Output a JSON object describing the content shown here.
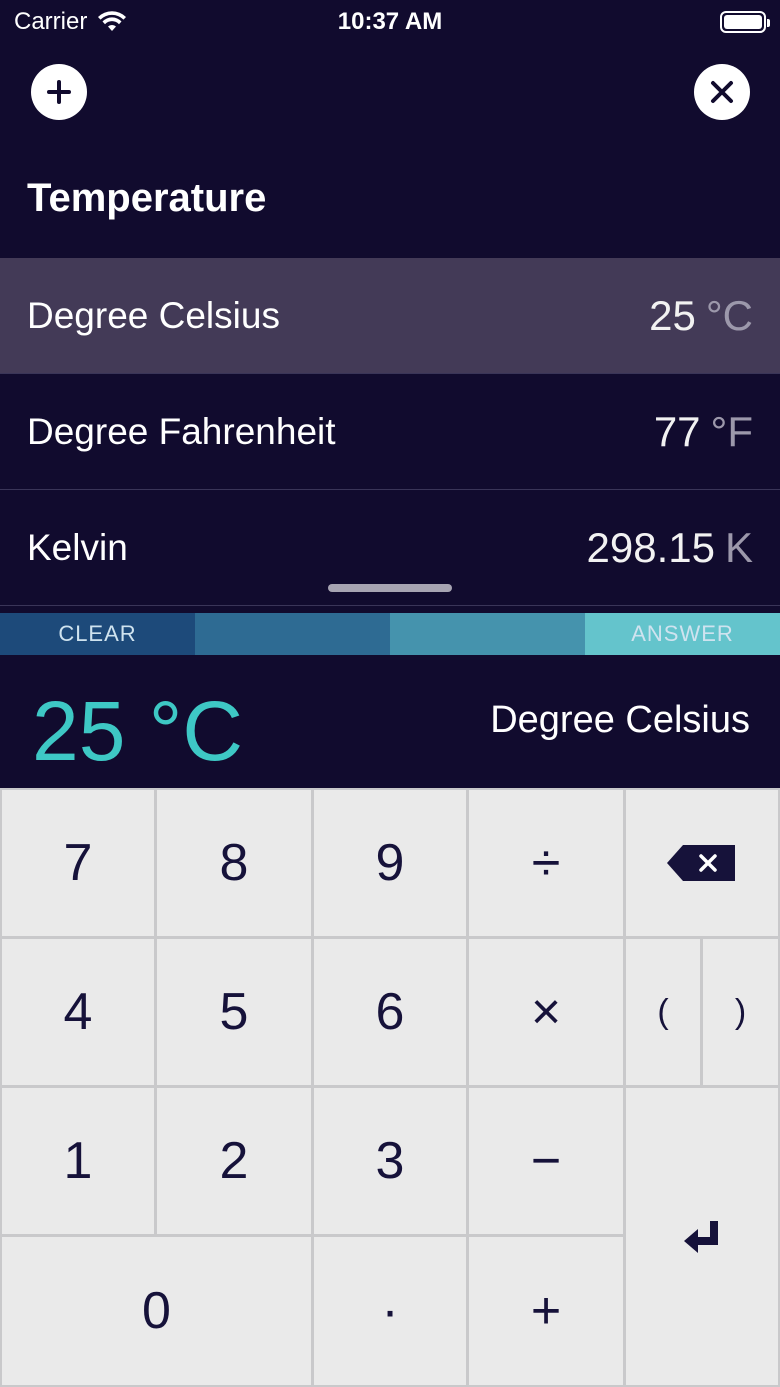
{
  "status_bar": {
    "carrier": "Carrier",
    "time": "10:37 AM"
  },
  "header": {
    "title": "Temperature",
    "add_icon": "plus-icon",
    "close_icon": "close-icon"
  },
  "units": [
    {
      "name": "Degree Celsius",
      "value": "25",
      "symbol": "°C",
      "selected": true
    },
    {
      "name": "Degree Fahrenheit",
      "value": "77",
      "symbol": "°F",
      "selected": false
    },
    {
      "name": "Kelvin",
      "value": "298.15",
      "symbol": "K",
      "selected": false
    }
  ],
  "action_bar": {
    "clear_label": "CLEAR",
    "answer_label": "ANSWER",
    "colors": [
      "#1d4a7a",
      "#2e6b93",
      "#4593ad",
      "#64c4cc"
    ]
  },
  "display": {
    "value": "25 °C",
    "unit_name": "Degree Celsius"
  },
  "keypad": {
    "k7": "7",
    "k8": "8",
    "k9": "9",
    "divide": "÷",
    "k4": "4",
    "k5": "5",
    "k6": "6",
    "multiply": "×",
    "open_paren": "(",
    "close_paren": ")",
    "k1": "1",
    "k2": "2",
    "k3": "3",
    "minus": "−",
    "k0": "0",
    "dot": "·",
    "plus": "+",
    "backspace_icon": "backspace-icon",
    "enter_icon": "enter-icon"
  },
  "colors": {
    "background": "#110b2e",
    "selected_row": "#433a57",
    "accent": "#3ec8c5",
    "key_bg": "#eaeaea",
    "key_text": "#16123a"
  }
}
